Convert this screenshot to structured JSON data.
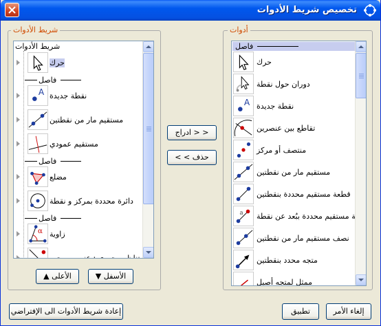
{
  "window": {
    "title": "تخصيص شريط الأدوات"
  },
  "left_panel": {
    "legend": "شريط الأدوات",
    "root_label": "شريط الأدوات",
    "items": [
      {
        "type": "tool",
        "icon": "move-arrow-icon",
        "label": "حرك",
        "selected": true
      },
      {
        "type": "separator",
        "label": "فاصل"
      },
      {
        "type": "tool",
        "icon": "new-point-icon",
        "label": "نقطة جديدة"
      },
      {
        "type": "tool",
        "icon": "line-through-two-points-icon",
        "label": "مستقيم مار من نقطتين"
      },
      {
        "type": "tool",
        "icon": "perpendicular-line-icon",
        "label": "مستقيم عمودي"
      },
      {
        "type": "separator",
        "label": "فاصل"
      },
      {
        "type": "tool",
        "icon": "polygon-icon",
        "label": "مضلع"
      },
      {
        "type": "tool",
        "icon": "circle-center-point-icon",
        "label": "دائرة محددة بمركز و نقطة"
      },
      {
        "type": "separator",
        "label": "فاصل"
      },
      {
        "type": "tool",
        "icon": "angle-icon",
        "label": "زاوية"
      },
      {
        "type": "tool",
        "icon": "reflect-about-line-icon",
        "label": "تناظر محوري : عنصر , محور"
      }
    ]
  },
  "right_panel": {
    "legend": "أدوات",
    "items": [
      {
        "type": "separator",
        "label": "فاصل",
        "selected": true
      },
      {
        "type": "tool",
        "icon": "move-arrow-icon",
        "label": "حرك"
      },
      {
        "type": "tool",
        "icon": "rotate-around-point-icon",
        "label": "دوران حول نقطة"
      },
      {
        "type": "tool",
        "icon": "new-point-icon",
        "label": "نقطة جديدة"
      },
      {
        "type": "tool",
        "icon": "intersect-two-objects-icon",
        "label": "تقاطع بين عنصرين"
      },
      {
        "type": "tool",
        "icon": "midpoint-icon",
        "label": "منتصف أو مركز"
      },
      {
        "type": "tool",
        "icon": "line-through-two-points-icon",
        "label": "مستقيم مار من نقطتين"
      },
      {
        "type": "tool",
        "icon": "segment-two-points-icon",
        "label": "قطعة مستقيم محددة بنقطتين"
      },
      {
        "type": "tool",
        "icon": "segment-given-length-icon",
        "label": "قطعة مستقيم محددة ببُعد عن نقطة"
      },
      {
        "type": "tool",
        "icon": "ray-icon",
        "label": "نصف مستقيم مار من نقطتين"
      },
      {
        "type": "tool",
        "icon": "vector-icon",
        "label": "متجه محدد بنقطتين"
      },
      {
        "type": "tool",
        "icon": "vector-from-point-icon",
        "label": "ممثل لمتجه أصيل"
      }
    ]
  },
  "buttons": {
    "insert": "< < ادراج",
    "remove": "حذف > >",
    "up": "الأعلى",
    "down": "الأسفل",
    "reset": "إعادة شريط الأدوات الى الإفتراضي",
    "apply": "تطبيق",
    "cancel": "إلغاء الأمر"
  },
  "colors": {
    "legend": "#d04a00",
    "selection": "#c7cdef",
    "accent_blue": "#1d3c9f",
    "accent_red": "#cc0000"
  }
}
